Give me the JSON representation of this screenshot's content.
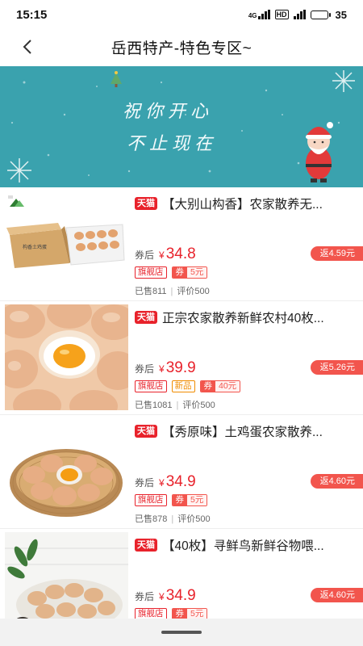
{
  "status": {
    "time": "15:15",
    "network_label": "4G",
    "hd_label": "HD",
    "battery": "35",
    "battery_level": 0.35
  },
  "nav": {
    "back_icon": "chevron-left-icon",
    "title": "岳西特产-特色专区~"
  },
  "banner": {
    "line1": "祝你开心",
    "line2": "不止现在",
    "colors": {
      "background": "#3aa2ae"
    }
  },
  "products": [
    {
      "platform": "天猫",
      "title": "【大别山构香】农家散养无...",
      "after_coupon": "券后",
      "currency": "¥",
      "price": "34.8",
      "rebate": "返4.59元",
      "tags": [
        "旗舰店"
      ],
      "coupon_prefix": "券",
      "coupon_value": "5元",
      "sold": "已售811",
      "reviews": "评价500"
    },
    {
      "platform": "天猫",
      "title": "正宗农家散养新鲜农村40枚...",
      "after_coupon": "券后",
      "currency": "¥",
      "price": "39.9",
      "rebate": "返5.26元",
      "tags": [
        "旗舰店",
        "新品"
      ],
      "coupon_prefix": "券",
      "coupon_value": "40元",
      "sold": "已售1081",
      "reviews": "评价500"
    },
    {
      "platform": "天猫",
      "title": "【秀原味】土鸡蛋农家散养...",
      "after_coupon": "券后",
      "currency": "¥",
      "price": "34.9",
      "rebate": "返4.60元",
      "tags": [
        "旗舰店"
      ],
      "coupon_prefix": "券",
      "coupon_value": "5元",
      "sold": "已售878",
      "reviews": "评价500"
    },
    {
      "platform": "天猫",
      "title": "【40枚】寻鲜鸟新鲜谷物喂...",
      "after_coupon": "券后",
      "currency": "¥",
      "price": "34.9",
      "rebate": "返4.60元",
      "tags": [
        "旗舰店"
      ],
      "coupon_prefix": "券",
      "coupon_value": "5元",
      "sold": "",
      "reviews": ""
    }
  ],
  "colors": {
    "accent": "#e8222b",
    "rebate": "#f2554d"
  }
}
